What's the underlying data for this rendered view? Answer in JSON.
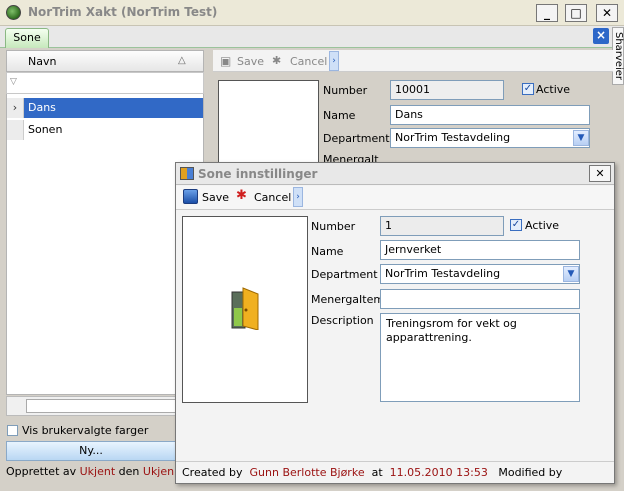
{
  "window": {
    "title": "NorTrim Xakt (NorTrim Test)",
    "minimize": "_",
    "maximize": "□",
    "close": "✕"
  },
  "tabs": {
    "active": "Sone",
    "side_tab": "Sharveier"
  },
  "list": {
    "column": "Navn",
    "rows": [
      {
        "label": "Dans",
        "selected": true
      },
      {
        "label": "Sonen",
        "selected": false
      }
    ]
  },
  "options": {
    "vis_label": "Vis brukervalgte farger",
    "new_button": "Ny..."
  },
  "footer_left": {
    "created_by_label": "Opprettet av",
    "created_by": "Ukjent",
    "on_label": "den",
    "on_value": "Ukjen"
  },
  "detail": {
    "save": "Save",
    "cancel": "Cancel",
    "number_label": "Number",
    "number": "10001",
    "active_label": "Active",
    "name_label": "Name",
    "name": "Dans",
    "department_label": "Department",
    "department": "NorTrim Testavdeling",
    "menerga_label": "MenergaIt"
  },
  "dialog": {
    "title": "Sone innstillinger",
    "save": "Save",
    "cancel": "Cancel",
    "number_label": "Number",
    "number": "1",
    "active_label": "Active",
    "name_label": "Name",
    "name": "Jernverket",
    "department_label": "Department",
    "department": "NorTrim Testavdeling",
    "menerga_label": "MenergaItem",
    "menerga": "",
    "description_label": "Description",
    "description": "Treningsrom for vekt og apparattrening.",
    "footer": {
      "created_by_label": "Created by",
      "created_by": "Gunn Berlotte Bjørke",
      "at_label": "at",
      "at": "11.05.2010 13:53",
      "modified_label": "Modified by"
    }
  }
}
